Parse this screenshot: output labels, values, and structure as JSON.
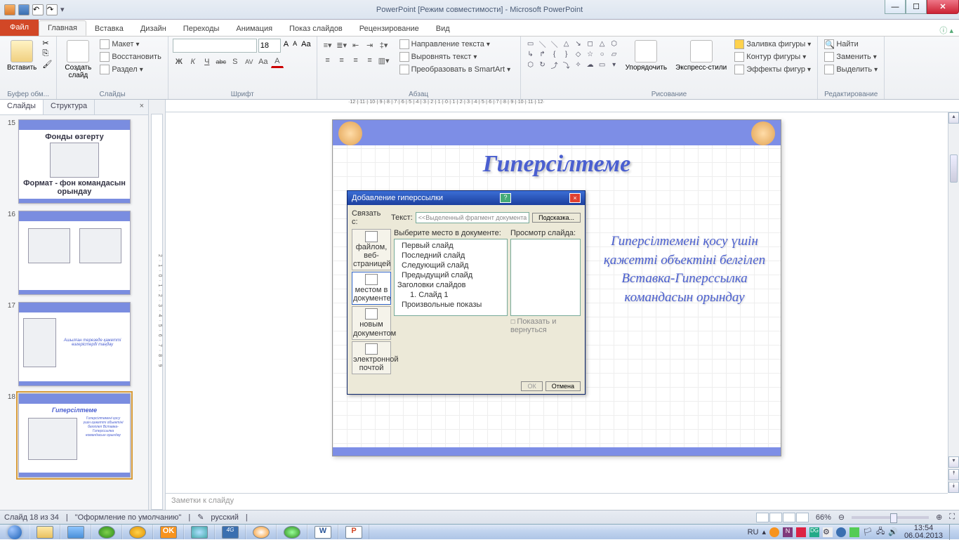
{
  "title": "PowerPoint [Режим совместимости] - Microsoft PowerPoint",
  "file_tab": "Файл",
  "tabs": [
    "Главная",
    "Вставка",
    "Дизайн",
    "Переходы",
    "Анимация",
    "Показ слайдов",
    "Рецензирование",
    "Вид"
  ],
  "ribbon": {
    "clipboard": {
      "paste": "Вставить",
      "label": "Буфер обм..."
    },
    "slides": {
      "new": "Создать\nслайд",
      "layout": "Макет",
      "reset": "Восстановить",
      "section": "Раздел",
      "label": "Слайды"
    },
    "font": {
      "family": "",
      "size": "18",
      "bold": "Ж",
      "italic": "К",
      "underline": "Ч",
      "strike": "abc",
      "shadow": "S",
      "spacing": "AV",
      "case": "Aa",
      "grow": "A",
      "shrink": "A",
      "clear": "Aa",
      "color": "A",
      "label": "Шрифт"
    },
    "paragraph": {
      "label": "Абзац",
      "dir": "Направление текста",
      "align": "Выровнять текст",
      "smart": "Преобразовать в SmartArt"
    },
    "drawing": {
      "arrange": "Упорядочить",
      "styles": "Экспресс-стили",
      "fill": "Заливка фигуры",
      "outline": "Контур фигуры",
      "effects": "Эффекты фигур",
      "label": "Рисование"
    },
    "editing": {
      "find": "Найти",
      "replace": "Заменить",
      "select": "Выделить",
      "label": "Редактирование"
    }
  },
  "panel": {
    "tab1": "Слайды",
    "tab2": "Структура"
  },
  "thumbs": [
    {
      "n": "15",
      "title": "Фонды өзгерту",
      "sub": "Формат - фон командасын орындау"
    },
    {
      "n": "16",
      "title": ""
    },
    {
      "n": "17",
      "title": "",
      "side": "Ашылған терезеде қажетті өзгерістерді таңдау"
    },
    {
      "n": "18",
      "title": "Гиперсілтеме",
      "active": true
    }
  ],
  "ruler_h": "·12·|·11·|·10·|·9·|·8·|·7·|·6·|·5·|·4·|·3·|·2·|·1·|·0·|·1·|·2·|·3·|·4·|·5·|·6·|·7·|·8·|·9·|·10·|·11·|·12·",
  "ruler_v": "2·1·0·1·2·3·4·5·6·7·8·9",
  "slide": {
    "title": "Гиперсілтеме",
    "side_text": "Гиперсілтемені қосу үшін қажетті объектіні белгілеп Вставка-Гиперссылка командасын орындау"
  },
  "dialog": {
    "title": "Добавление гиперссылки",
    "link_label": "Связать с:",
    "text_label": "Текст:",
    "text_placeholder": "<<Выделенный фрагмент документа>>",
    "tip_btn": "Подсказка...",
    "select_label": "Выберите место в документе:",
    "preview_label": "Просмотр слайда:",
    "linkto": [
      "файлом, веб-\nстраницей",
      "местом в\nдокументе",
      "новым\nдокументом",
      "электронной\nпочтой"
    ],
    "places": [
      "Первый слайд",
      "Последний слайд",
      "Следующий слайд",
      "Предыдущий слайд",
      "Заголовки слайдов",
      "  1. Слайд 1",
      "Произвольные показы"
    ],
    "show_return": "Показать и вернуться",
    "ok": "ОК",
    "cancel": "Отмена"
  },
  "notes": "Заметки к слайду",
  "status": {
    "slide": "Слайд 18 из 34",
    "theme": "\"Оформление по умолчанию\"",
    "lang": "русский",
    "zoom": "66%"
  },
  "tray": {
    "lang": "RU",
    "time": "13:54",
    "date": "06.04.2013"
  }
}
